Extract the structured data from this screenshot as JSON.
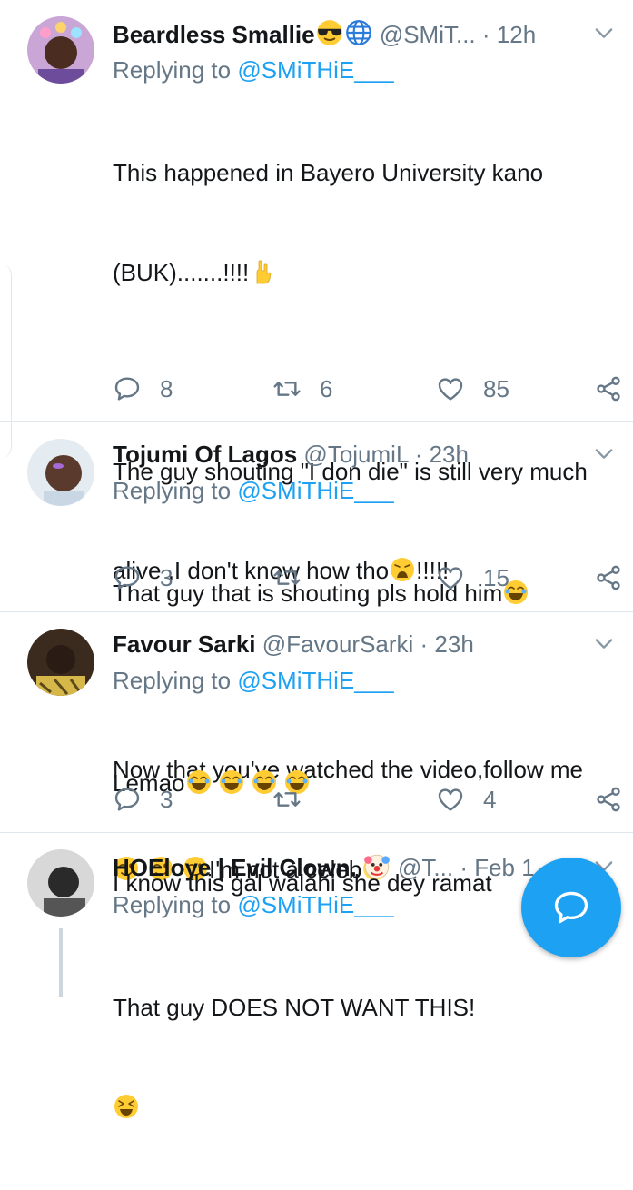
{
  "tweets": [
    {
      "name": "Beardless Smallie",
      "handle": "@SMiT...",
      "time": "· 12h",
      "replying_prefix": "Replying to ",
      "replying_to": "@SMiTHiE___",
      "line1": "This happened in Bayero University kano",
      "line2": "(BUK).......!!!!",
      "line3": "The guy shouting \"I don die\" is still very much",
      "line4a": "alive ,I don't know how tho",
      "line4b": "!!!!!",
      "line5": "Now that you've watched the video,follow me",
      "line6": "I'm not a celeb",
      "replies": "8",
      "retweets": "6",
      "likes": "85"
    },
    {
      "name": "Tojumi Of Lagos",
      "handle": "@TojumiL",
      "time": "· 23h",
      "replying_prefix": "Replying to ",
      "replying_to": "@SMiTHiE___",
      "line1": "That guy that is shouting pls hold him",
      "replies": "3",
      "retweets": "",
      "likes": "15"
    },
    {
      "name": "Favour Sarki",
      "handle": "@FavourSarki",
      "time": "· 23h",
      "replying_prefix": "Replying to ",
      "replying_to": "@SMiTHiE___",
      "line1": "Lemao",
      "line2": "I know this gal walahi she dey ramat",
      "replies": "3",
      "retweets": "",
      "likes": "4"
    },
    {
      "name": "HOEloye | Evil Clown.",
      "handle": "@T...",
      "time": "· Feb 1",
      "replying_prefix": "Replying to ",
      "replying_to": "@SMiTHiE___",
      "line1": "That guy DOES NOT WANT THIS!"
    }
  ],
  "icons": {
    "reply": "reply-icon",
    "retweet": "retweet-icon",
    "like": "heart-icon",
    "share": "share-icon",
    "compose": "compose-reply-icon"
  },
  "colors": {
    "accent": "#1da1f2",
    "muted": "#657786",
    "text": "#14171a",
    "divider": "#e1e8ed"
  }
}
